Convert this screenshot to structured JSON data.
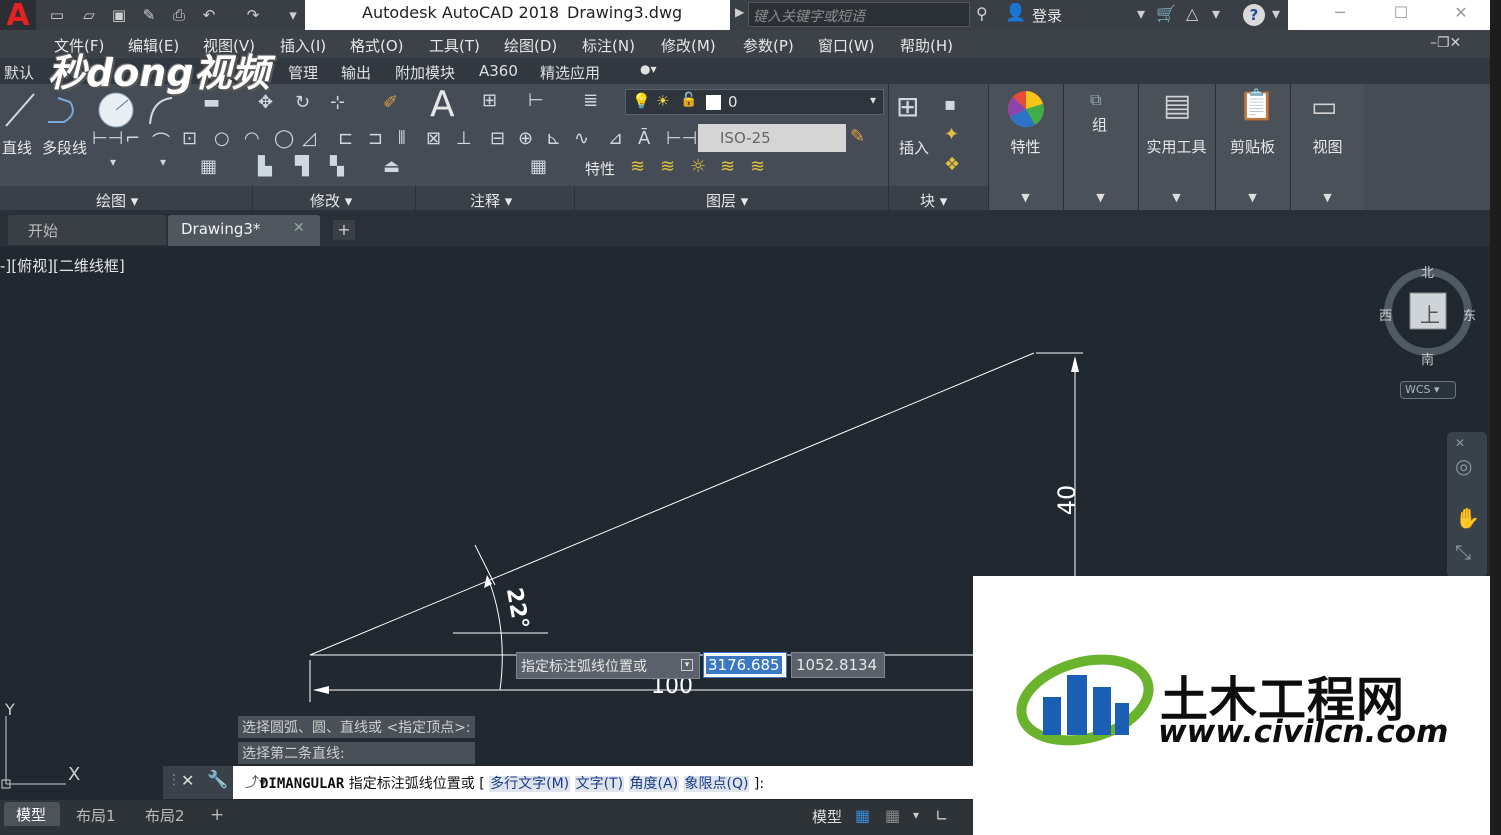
{
  "app": {
    "title": "Autodesk AutoCAD 2018",
    "document": "Drawing3.dwg"
  },
  "search": {
    "placeholder": "键入关键字或短语"
  },
  "account": {
    "signin": "登录"
  },
  "menu": [
    "文件(F)",
    "编辑(E)",
    "视图(V)",
    "插入(I)",
    "格式(O)",
    "工具(T)",
    "绘图(D)",
    "标注(N)",
    "修改(M)",
    "参数(P)",
    "窗口(W)",
    "帮助(H)"
  ],
  "ribbon_tabs": [
    "默认",
    "管理",
    "输出",
    "附加模块",
    "A360",
    "精选应用"
  ],
  "watermark_top": "秒dong视频",
  "ribbon": {
    "draw_line": "直线",
    "draw_polyline": "多段线",
    "layer_value": "0",
    "dimstyle_value": "ISO-25",
    "properties_small": "特性",
    "insert": "插入",
    "panels": [
      "绘图",
      "修改",
      "注释",
      "图层",
      "块"
    ],
    "big_panels": [
      "特性",
      "组",
      "实用工具",
      "剪贴板",
      "视图"
    ]
  },
  "file_tabs": {
    "start": "开始",
    "drawing": "Drawing3*"
  },
  "viewport": {
    "label": "-][俯视][二维线框]"
  },
  "viewcube": {
    "north": "北",
    "south": "南",
    "east": "东",
    "west": "西",
    "face": "上",
    "wcs": "WCS"
  },
  "drawing": {
    "dim_vertical": "40",
    "dim_angle": "22°",
    "dim_horizontal": "100"
  },
  "ucs": {
    "y": "Y",
    "x": "X"
  },
  "dynamic_input": {
    "prompt": "指定标注弧线位置或",
    "value1": "3176.685",
    "value2": "1052.8134"
  },
  "history": [
    "选择圆弧、圆、直线或 <指定顶点>:",
    "选择第二条直线:"
  ],
  "command": {
    "name": "DIMANGULAR",
    "prompt": "指定标注弧线位置或 [",
    "options": [
      "多行文字(M)",
      "文字(T)",
      "角度(A)",
      "象限点(Q)"
    ],
    "suffix": "]:"
  },
  "layout_tabs": [
    "模型",
    "布局1",
    "布局2"
  ],
  "status": {
    "model": "模型"
  },
  "watermark_logo": {
    "name": "土木工程网",
    "url": "www.civilcn.com"
  },
  "colors": {
    "canvas": "#212830",
    "accent": "#3a78c4",
    "logo_blue": "#1a5fb4",
    "logo_green": "#6ab42d"
  }
}
